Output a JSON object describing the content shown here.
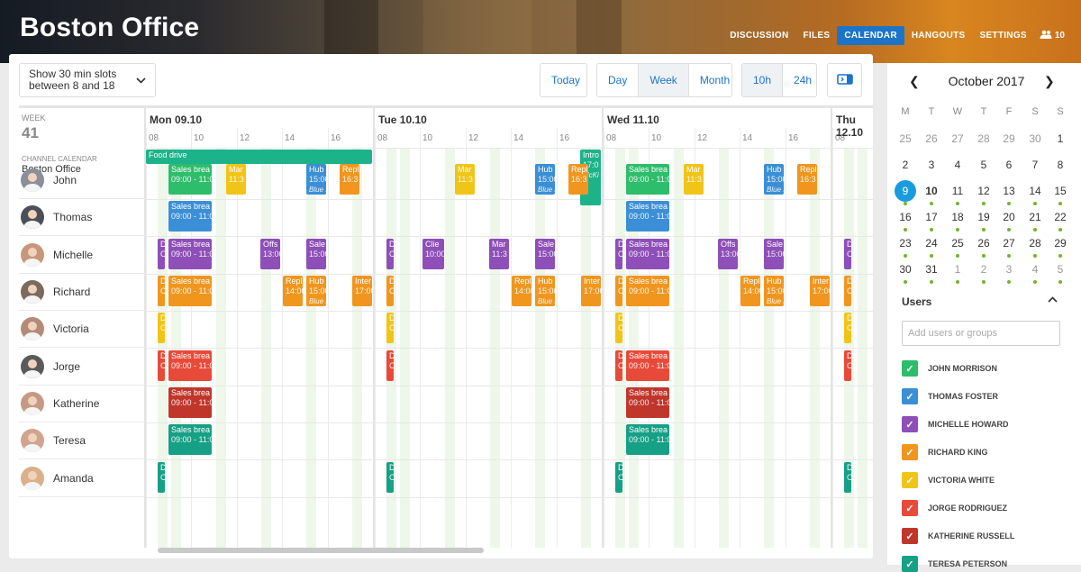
{
  "header": {
    "title": "Boston Office",
    "nav": [
      "DISCUSSION",
      "FILES",
      "CALENDAR",
      "HANGOUTS",
      "SETTINGS"
    ],
    "active_nav": "CALENDAR",
    "user_count": "10"
  },
  "toolbar": {
    "slots_label": "Show 30 min slots between 8 and 18",
    "today": "Today",
    "views": [
      "Day",
      "Week",
      "Month"
    ],
    "active_view": "Week",
    "ranges": [
      "10h",
      "24h"
    ],
    "active_range": "10h"
  },
  "grid": {
    "week_label": "WEEK",
    "week_number": "41",
    "channel_label": "CHANNEL CALENDAR",
    "channel_name": "Boston Office",
    "days": [
      "Mon 09.10",
      "Tue 10.10",
      "Wed 11.10",
      "Thu 12.10"
    ],
    "hours": [
      "08",
      "10",
      "12",
      "14",
      "16"
    ],
    "people": [
      "John",
      "Thomas",
      "Michelle",
      "Richard",
      "Victoria",
      "Jorge",
      "Katherine",
      "Teresa",
      "Amanda"
    ],
    "channel_events": [
      {
        "title": "Food drive",
        "time": "",
        "sub": ""
      },
      {
        "title": "Intro",
        "time": "17:0",
        "sub": "McKi"
      }
    ]
  },
  "calendar": {
    "month": "October 2017",
    "weekdays": [
      "M",
      "T",
      "W",
      "T",
      "F",
      "S",
      "S"
    ],
    "weeks": [
      [
        "25",
        "26",
        "27",
        "28",
        "29",
        "30",
        "1"
      ],
      [
        "2",
        "3",
        "4",
        "5",
        "6",
        "7",
        "8"
      ],
      [
        "9",
        "10",
        "11",
        "12",
        "13",
        "14",
        "15"
      ],
      [
        "16",
        "17",
        "18",
        "19",
        "20",
        "21",
        "22"
      ],
      [
        "23",
        "24",
        "25",
        "26",
        "27",
        "28",
        "29"
      ],
      [
        "30",
        "31",
        "1",
        "2",
        "3",
        "4",
        "5"
      ]
    ],
    "today": "9"
  },
  "users": {
    "heading": "Users",
    "search_placeholder": "Add users or groups",
    "list": [
      {
        "name": "JOHN MORRISON",
        "color": "#2ebd6b"
      },
      {
        "name": "THOMAS FOSTER",
        "color": "#3b8fd6"
      },
      {
        "name": "MICHELLE HOWARD",
        "color": "#8e4fb8"
      },
      {
        "name": "RICHARD KING",
        "color": "#f0961f"
      },
      {
        "name": "VICTORIA WHITE",
        "color": "#f1c418"
      },
      {
        "name": "JORGE RODRIGUEZ",
        "color": "#e84a3a"
      },
      {
        "name": "KATHERINE RUSSELL",
        "color": "#c0362b"
      },
      {
        "name": "TERESA PETERSON",
        "color": "#16a085"
      }
    ]
  },
  "colors": {
    "green": "#2ebd6b",
    "blue": "#3b8fd6",
    "purple": "#8e4fb8",
    "orange": "#f0961f",
    "yellow": "#f1c418",
    "red": "#e84a3a",
    "darkred": "#c0362b",
    "teal": "#16a085",
    "channel": "#1db38a"
  },
  "events_text": {
    "sales": "Sales brea",
    "sales_time": "09:00 - 11:0",
    "mar": "Mar",
    "mar_time": "11:3",
    "hub": "Hub",
    "hub_time": "15:00",
    "hub_sub": "Blue I",
    "rep": "Repl",
    "rep_time": "16:3",
    "offs": "Offs",
    "offs_time": "13:00",
    "sale2": "Sale",
    "sale2_time": "15:00",
    "clie": "Clie",
    "clie_time": "10:00",
    "rep2": "Repl",
    "rep2_time": "14:00",
    "inter": "Inter",
    "inter_time": "17:00",
    "d": "D",
    "dd": "C",
    "ds": "S"
  }
}
